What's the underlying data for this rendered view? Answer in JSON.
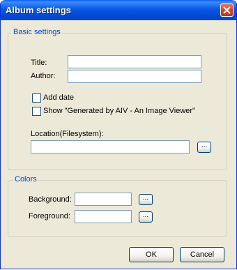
{
  "window": {
    "title": "Album settings"
  },
  "basic": {
    "legend": "Basic settings",
    "title_label": "Title:",
    "title_value": "",
    "author_label": "Author:",
    "author_value": "",
    "add_date_label": "Add date",
    "add_date_checked": false,
    "show_generated_label": "Show \"Generated by AIV - An Image Viewer\"",
    "show_generated_checked": false,
    "location_label": "Location(Filesystem):",
    "location_value": "",
    "browse_label": "..."
  },
  "colors": {
    "legend": "Colors",
    "background_label": "Background:",
    "background_value": "",
    "background_browse": "...",
    "foreground_label": "Foreground:",
    "foreground_value": "",
    "foreground_browse": "..."
  },
  "buttons": {
    "ok": "OK",
    "cancel": "Cancel"
  },
  "theme": {
    "titlebar": "#0a58e6",
    "face": "#ece9d8",
    "legend": "#0046d5",
    "close": "#d2452d"
  }
}
